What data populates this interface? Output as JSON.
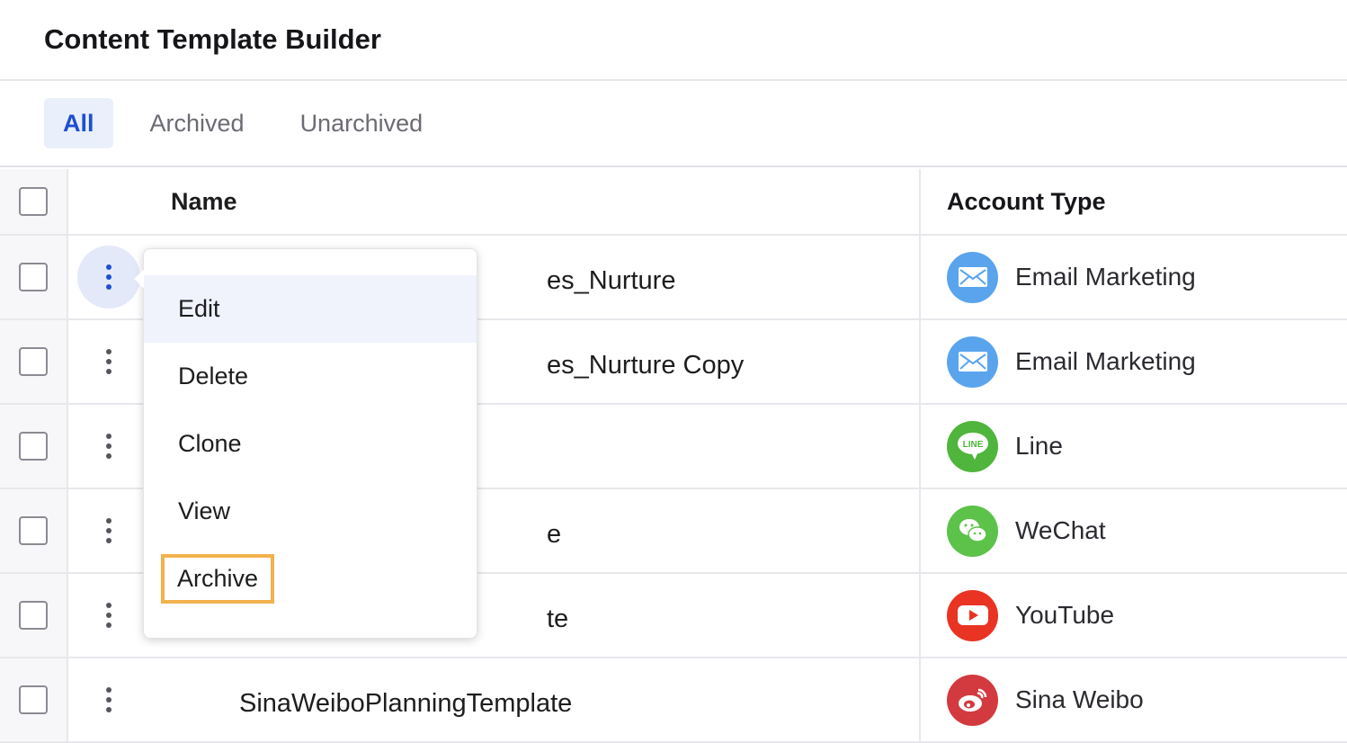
{
  "header": {
    "title": "Content Template Builder"
  },
  "tabs": [
    {
      "label": "All",
      "active": true
    },
    {
      "label": "Archived"
    },
    {
      "label": "Unarchived"
    }
  ],
  "table": {
    "columns": {
      "name": "Name",
      "account_type": "Account Type"
    },
    "rows": [
      {
        "name_visible": "es_Nurture",
        "account_type": "Email Marketing",
        "icon": "email-icon",
        "color": "#5aa4ee"
      },
      {
        "name_visible": "es_Nurture Copy",
        "account_type": "Email Marketing",
        "icon": "email-icon",
        "color": "#5aa4ee"
      },
      {
        "name_visible": "",
        "account_type": "Line",
        "icon": "line-icon",
        "color": "#4fb53c"
      },
      {
        "name_visible": "e",
        "account_type": "WeChat",
        "icon": "wechat-icon",
        "color": "#5cc24a"
      },
      {
        "name_visible": "te",
        "account_type": "YouTube",
        "icon": "youtube-icon",
        "color": "#e93323"
      },
      {
        "name_visible": "SinaWeiboPlanningTemplate",
        "account_type": "Sina Weibo",
        "icon": "sina-weibo-icon",
        "color": "#d23a3f"
      }
    ]
  },
  "menu": {
    "items": [
      "Edit",
      "Delete",
      "Clone",
      "View",
      "Archive"
    ],
    "highlighted": "Edit",
    "focused": "Archive"
  },
  "colors": {
    "accent": "#1f4fd1",
    "focus_outline": "#f2b24c"
  }
}
